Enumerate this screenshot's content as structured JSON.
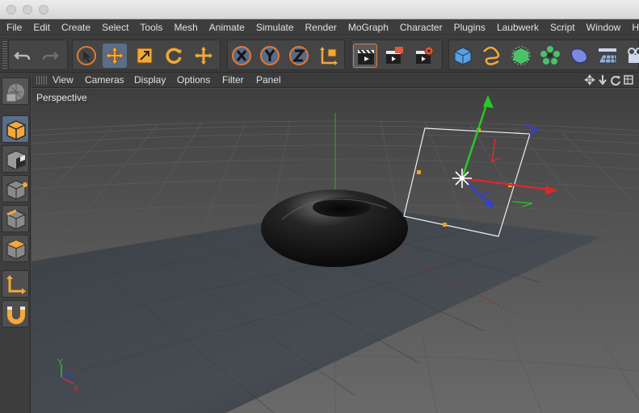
{
  "menubar": {
    "items": [
      "File",
      "Edit",
      "Create",
      "Select",
      "Tools",
      "Mesh",
      "Animate",
      "Simulate",
      "Render",
      "MoGraph",
      "Character",
      "Plugins",
      "Laubwerk",
      "Script",
      "Window",
      "He"
    ]
  },
  "viewport_menu": {
    "items": [
      "View",
      "Cameras",
      "Display",
      "Options",
      "Filter",
      "Panel"
    ]
  },
  "viewport": {
    "label": "Perspective",
    "axis_labels": {
      "y": "Y",
      "z": "Z",
      "x": "X"
    }
  },
  "colors": {
    "accent_selected": "#5a6e8c",
    "axis_x": "#e03030",
    "axis_y": "#30c030",
    "axis_z": "#3050e0",
    "handle": "#f0a020"
  },
  "toolbar_icons": [
    "undo-icon",
    "redo-icon",
    "live-selection-icon",
    "move-icon",
    "scale-icon",
    "rotate-icon",
    "recent-tool-icon",
    "x-axis-lock-icon",
    "y-axis-lock-icon",
    "z-axis-lock-icon",
    "coordinate-system-icon",
    "render-view-icon",
    "render-to-picture-viewer-icon",
    "render-settings-icon",
    "cube-icon",
    "spline-icon",
    "nurbs-icon",
    "array-icon",
    "deformer-icon",
    "floor-icon",
    "camera-icon"
  ],
  "sidebar_icons": [
    "make-editable-icon",
    "model-mode-icon",
    "texture-mode-icon",
    "points-mode-icon",
    "edges-mode-icon",
    "polygons-mode-icon",
    "enable-axis-icon",
    "snap-icon"
  ]
}
